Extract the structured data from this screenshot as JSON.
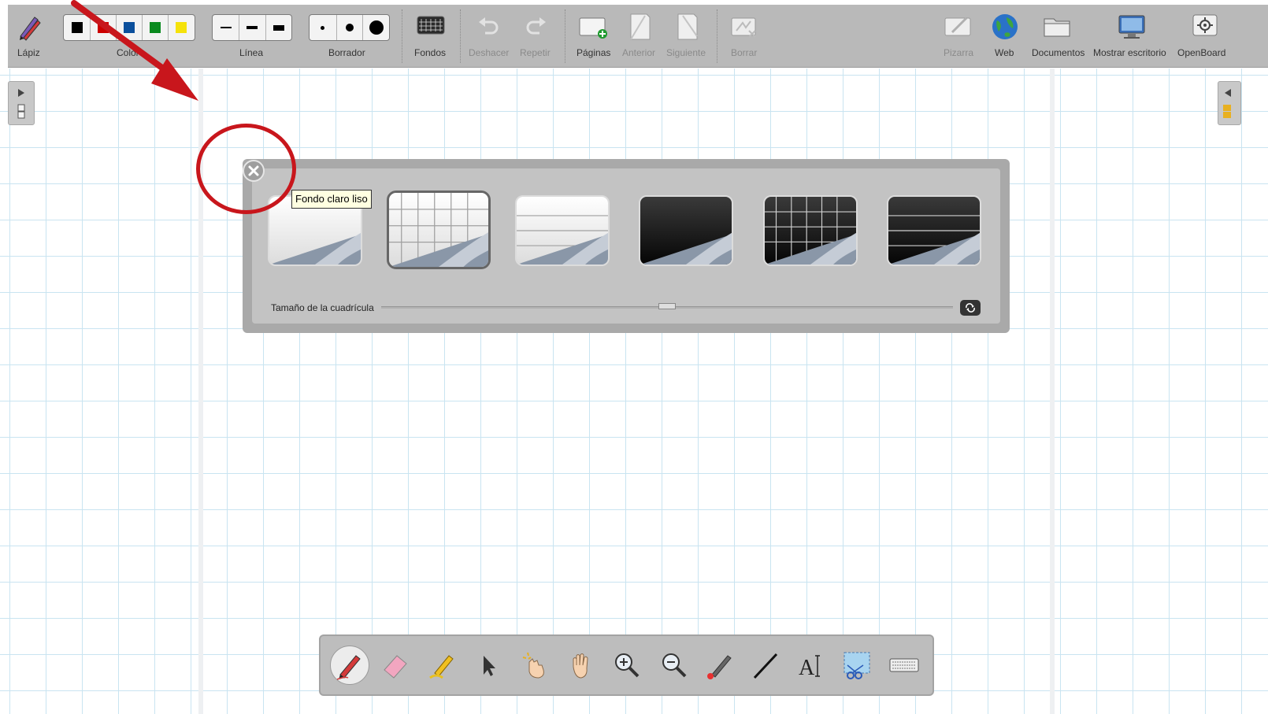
{
  "toolbar": {
    "lapiz": "Lápiz",
    "color_label": "Color",
    "linea": "Línea",
    "borrador": "Borrador",
    "fondos": "Fondos",
    "deshacer": "Deshacer",
    "repetir": "Repetir",
    "paginas": "Páginas",
    "anterior": "Anterior",
    "siguiente": "Siguiente",
    "borrar": "Borrar",
    "pizarra": "Pizarra",
    "web": "Web",
    "documentos": "Documentos",
    "mostrar_escritorio": "Mostrar escritorio",
    "openboard": "OpenBoard"
  },
  "colors": [
    "#000000",
    "#cc0000",
    "#0b4f9c",
    "#0a8a1f",
    "#f5e20a"
  ],
  "background_palette": {
    "tooltip": "Fondo claro liso",
    "grid_size_label": "Tamaño de la cuadrícula",
    "grid_size_fraction": 0.5,
    "selected_index": 1,
    "backgrounds": [
      {
        "style": "light-plain"
      },
      {
        "style": "light-grid"
      },
      {
        "style": "light-lined"
      },
      {
        "style": "dark-plain"
      },
      {
        "style": "dark-grid"
      },
      {
        "style": "dark-lined"
      }
    ]
  },
  "stylus_palette": {
    "active_tool": "pen",
    "tools": [
      "pen-icon",
      "eraser-icon",
      "marker-icon",
      "selector-icon",
      "play-icon",
      "hand-icon",
      "zoom-in-icon",
      "zoom-out-icon",
      "laser-pointer-icon",
      "line-icon",
      "text-icon",
      "capture-icon",
      "keyboard-icon"
    ]
  },
  "annotation_color": "#c8161c"
}
